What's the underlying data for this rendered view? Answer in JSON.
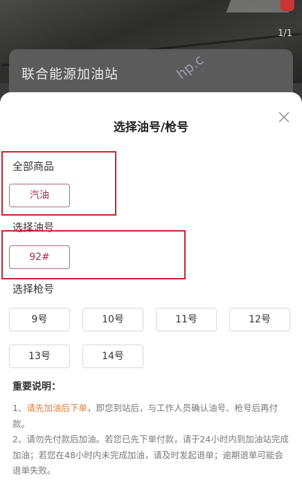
{
  "background": {
    "image_counter": "1/1",
    "station_name": "联合能源加油站",
    "watermark": "hp.c"
  },
  "sheet": {
    "title": "选择油号/枪号",
    "close_icon": "close-icon",
    "sections": {
      "product": {
        "label": "全部商品",
        "options": [
          "汽油"
        ],
        "selected": "汽油"
      },
      "fuel": {
        "label": "选择油号",
        "options": [
          "92#"
        ],
        "selected": "92#"
      },
      "nozzle": {
        "label": "选择枪号",
        "options": [
          "9号",
          "10号",
          "11号",
          "12号",
          "13号",
          "14号"
        ]
      }
    },
    "notes": {
      "title": "重要说明：",
      "item1_prefix": "1、",
      "item1_highlight": "请先加油后下单",
      "item1_rest": "，即您到站后，与工作人员确认油号、枪号后再付款。",
      "item2": "2、请勿先付款后加油。若您已先下单付款，请于24小时内到加油站完成加油；若您在48小时内未完成加油，请及时发起退单；逾期退单可能会退单失败。"
    }
  },
  "colors": {
    "highlight_box": "#c8222e",
    "selected_text": "#a33048",
    "note_emphasis": "#e07a35"
  }
}
